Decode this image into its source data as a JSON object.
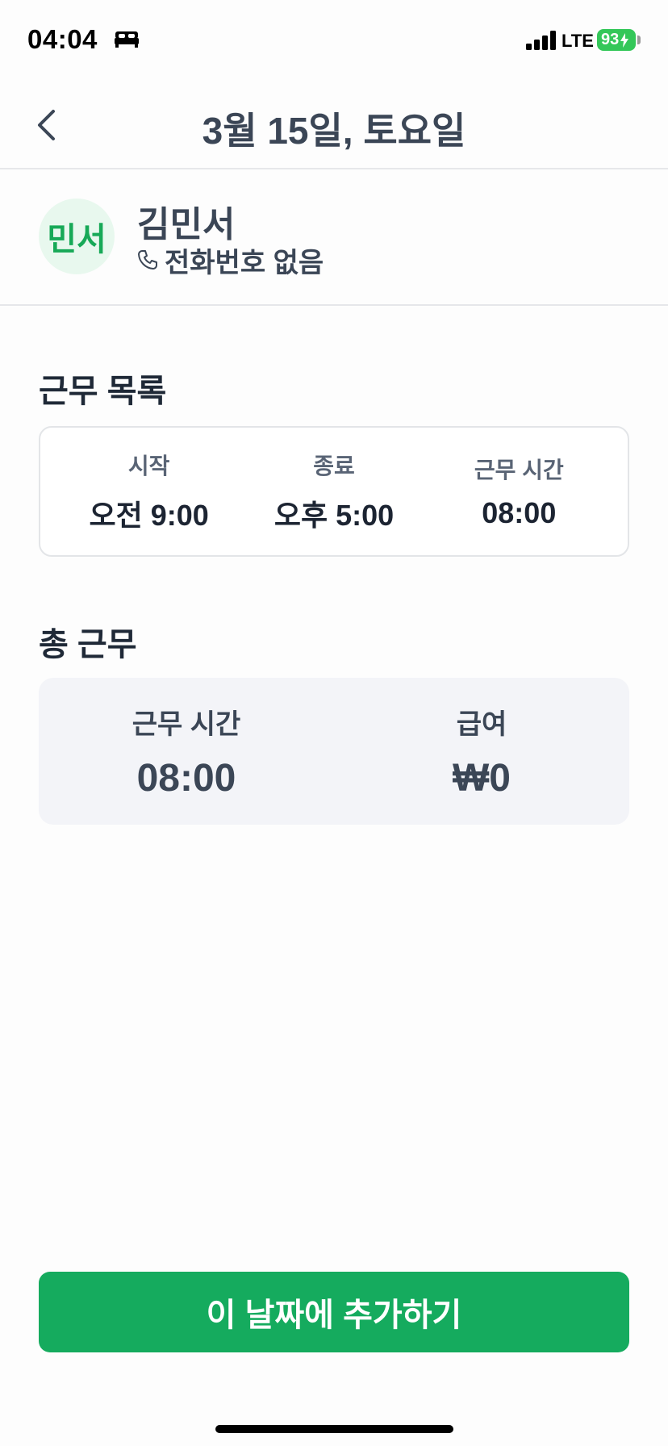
{
  "status_bar": {
    "time": "04:04",
    "network": "LTE",
    "battery": "93"
  },
  "header": {
    "title": "3월 15일, 토요일",
    "back_icon": "chevron-left-icon"
  },
  "profile": {
    "avatar_text": "민서",
    "name": "김민서",
    "phone": "전화번호 없음",
    "phone_icon": "phone-icon"
  },
  "shift_list": {
    "title": "근무 목록",
    "columns": [
      {
        "label": "시작",
        "value": "오전 9:00"
      },
      {
        "label": "종료",
        "value": "오후 5:00"
      },
      {
        "label": "근무 시간",
        "value": "08:00"
      }
    ]
  },
  "totals": {
    "title": "총 근무",
    "hours_label": "근무 시간",
    "hours_value": "08:00",
    "pay_label": "급여",
    "pay_value": "₩0"
  },
  "actions": {
    "add_label": "이 날짜에 추가하기"
  },
  "colors": {
    "accent": "#15ab5e",
    "avatar_bg": "#e8f8ee",
    "battery": "#34c759"
  }
}
